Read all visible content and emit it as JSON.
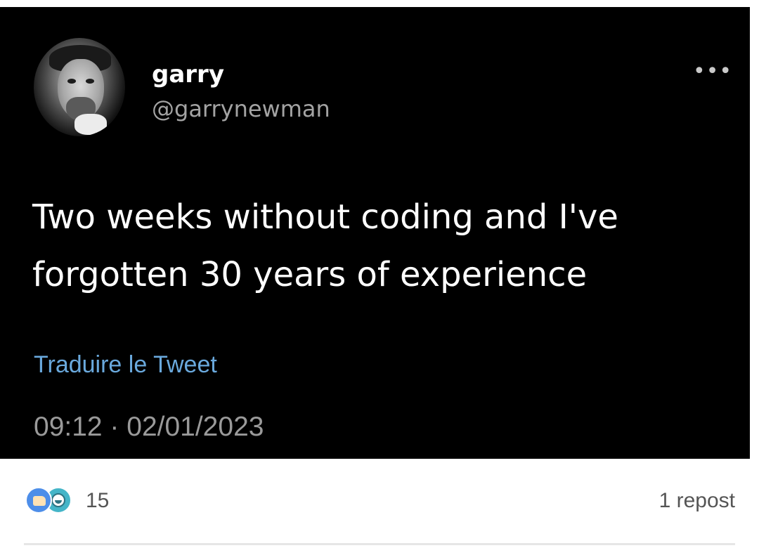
{
  "tweet": {
    "display_name": "garry",
    "handle": "@garrynewman",
    "text": "Two weeks without coding and I've forgotten 30 years of experience",
    "translate_label": "Traduire le Tweet",
    "timestamp": "09:12 · 02/01/2023",
    "more_label": "•••",
    "colors": {
      "background": "#000000",
      "link": "#6aa9dd"
    }
  },
  "social": {
    "reaction_count": "15",
    "repost_label": "1 repost",
    "icons": [
      "like-icon",
      "funny-icon"
    ]
  }
}
